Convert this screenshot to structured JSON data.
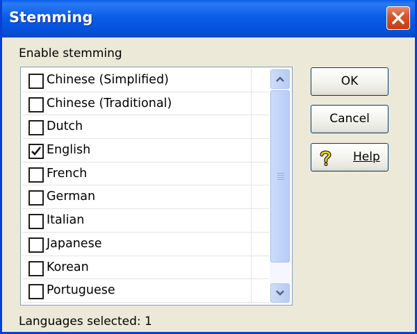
{
  "window": {
    "title": "Stemming"
  },
  "group": {
    "label": "Enable stemming"
  },
  "languages": [
    {
      "label": "Chinese (Simplified)",
      "checked": false
    },
    {
      "label": "Chinese (Traditional)",
      "checked": false
    },
    {
      "label": "Dutch",
      "checked": false
    },
    {
      "label": "English",
      "checked": true
    },
    {
      "label": "French",
      "checked": false
    },
    {
      "label": "German",
      "checked": false
    },
    {
      "label": "Italian",
      "checked": false
    },
    {
      "label": "Japanese",
      "checked": false
    },
    {
      "label": "Korean",
      "checked": false
    },
    {
      "label": "Portuguese",
      "checked": false
    }
  ],
  "buttons": {
    "ok": "OK",
    "cancel": "Cancel",
    "help": "Help"
  },
  "status": {
    "text": "Languages selected: 1"
  },
  "icons": {
    "close": "close-x-icon",
    "help": "question-mark-icon",
    "scroll_up": "chevron-up-icon",
    "scroll_down": "chevron-down-icon"
  },
  "colors": {
    "titlebar": "#0a5fe8",
    "close_button": "#d8542a",
    "dialog_background": "#ece9d8",
    "list_border": "#7f9db9",
    "scrollbar": "#b7cbf4"
  }
}
